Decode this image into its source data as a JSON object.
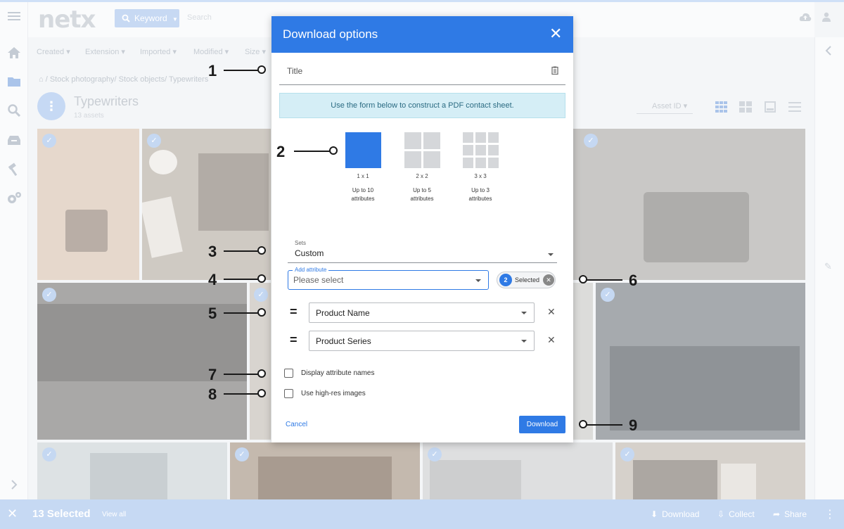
{
  "app": {
    "logo_text": "netx",
    "keyword_label": "Keyword",
    "search_placeholder": "Search",
    "filters": [
      "Created",
      "Extension",
      "Imported",
      "Modified",
      "Size"
    ],
    "breadcrumb": "/ Stock photography/ Stock objects/ Typewriters",
    "gallery_title": "Typewriters",
    "gallery_count": "13 assets",
    "sort_label": "Asset ID",
    "accent_color": "#2f7ae5"
  },
  "icons": {
    "menu": "menu-icon",
    "home": "home-icon",
    "folder": "folder-icon",
    "search": "search-icon",
    "inbox": "inbox-icon",
    "tools": "hammer-icon",
    "settings": "gears-icon",
    "upload": "cloud-upload-icon",
    "user": "user-icon",
    "close": "close-icon",
    "check": "check-icon",
    "pencil": "pencil-icon"
  },
  "bottom_bar": {
    "selected_text": "13 Selected",
    "view_all": "View all",
    "download": "Download",
    "collect": "Collect",
    "share": "Share"
  },
  "modal": {
    "title": "Download options",
    "title_field_label": "Title",
    "info_text": "Use the form below to construct a PDF contact sheet.",
    "layouts": [
      {
        "name": "1 x 1",
        "desc_line1": "Up to 10",
        "desc_line2": "attributes",
        "selected": true
      },
      {
        "name": "2 x 2",
        "desc_line1": "Up to 5",
        "desc_line2": "attributes",
        "selected": false
      },
      {
        "name": "3 x 3",
        "desc_line1": "Up to 3",
        "desc_line2": "attributes",
        "selected": false
      }
    ],
    "sets_label": "Sets",
    "sets_value": "Custom",
    "add_attribute_label": "Add attribute",
    "add_attribute_placeholder": "Please select",
    "chip_count": "2",
    "chip_label": "Selected",
    "attributes": [
      {
        "operator": "=",
        "value": "Product Name"
      },
      {
        "operator": "=",
        "value": "Product Series"
      }
    ],
    "checkbox_display_names": "Display attribute names",
    "checkbox_high_res": "Use high-res images",
    "cancel_label": "Cancel",
    "download_label": "Download"
  },
  "annotations": [
    "1",
    "2",
    "3",
    "4",
    "5",
    "6",
    "7",
    "8",
    "9"
  ]
}
